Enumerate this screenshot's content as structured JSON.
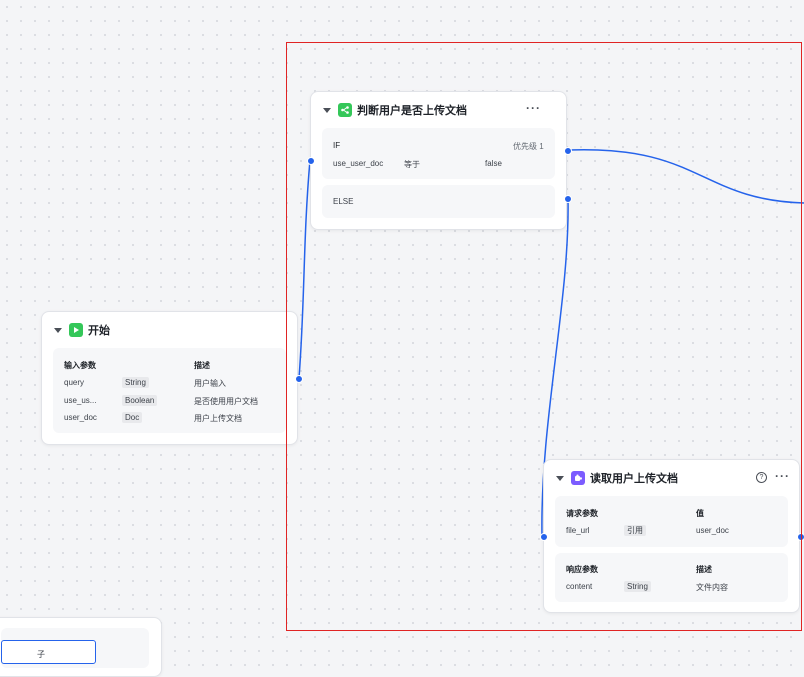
{
  "colors": {
    "selection": "#e02424",
    "edge": "#2563eb",
    "start_icon": "#34c759",
    "condition_icon": "#34c759",
    "plugin_icon": "#7c5cff"
  },
  "condition_node": {
    "title": "判断用户是否上传文档",
    "icon": "branch-icon",
    "if_label": "IF",
    "priority_label": "优先级 1",
    "condition": {
      "variable": "use_user_doc",
      "operator": "等于",
      "value": "false"
    },
    "else_label": "ELSE"
  },
  "start_node": {
    "title": "开始",
    "icon": "play-icon",
    "header_params": "输入参数",
    "header_desc": "描述",
    "params": [
      {
        "name": "query",
        "type": "String",
        "desc": "用户输入"
      },
      {
        "name": "use_us...",
        "type": "Boolean",
        "desc": "是否使用用户文档"
      },
      {
        "name": "user_doc",
        "type": "Doc",
        "desc": "用户上传文档"
      }
    ]
  },
  "plugin_node": {
    "title": "读取用户上传文档",
    "icon": "plugin-icon",
    "request": {
      "header_params": "请求参数",
      "header_value": "值",
      "rows": [
        {
          "name": "file_url",
          "type": "引用",
          "value": "user_doc"
        }
      ]
    },
    "response": {
      "header_params": "响应参数",
      "header_desc": "描述",
      "rows": [
        {
          "name": "content",
          "type": "String",
          "desc": "文件内容"
        }
      ]
    }
  },
  "partial_node": {
    "text": "子"
  }
}
